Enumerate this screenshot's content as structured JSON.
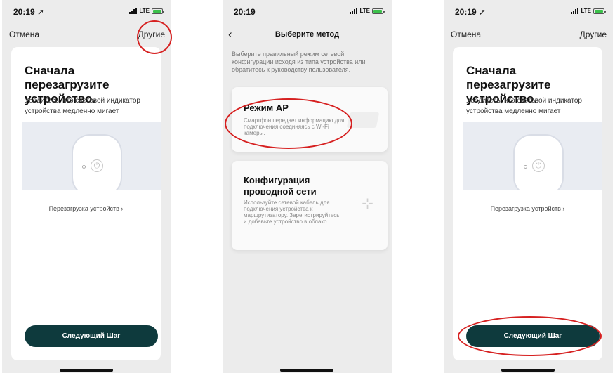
{
  "screens": [
    {
      "status": {
        "time": "20:19",
        "location_glyph": "➚",
        "network": "LTE"
      },
      "nav": {
        "left": "Отмена",
        "right": "Другие"
      },
      "title": "Сначала перезагрузите устройство.",
      "subtitle": "Убедитесь, что световой индикатор устройства медленно мигает",
      "link": "Перезагрузка устройств",
      "button": "Следующий Шаг"
    },
    {
      "status": {
        "time": "20:19",
        "network": "LTE"
      },
      "nav": {
        "back": "‹",
        "title": "Выберите метод"
      },
      "instruction": "Выберите правильный режим сетевой конфигурации исходя из типа устройства или обратитесь к руководству пользователя.",
      "methods": [
        {
          "title": "Режим AP",
          "desc": "Смартфон передает информацию для подключения соединяясь с Wi-Fi камеры."
        },
        {
          "title": "Конфигурация проводной сети",
          "desc": "Используйте сетевой кабель для подключения устройства к маршрутизатору. Зарегистрируйтесь и добавьте устройство в облако."
        }
      ]
    },
    {
      "status": {
        "time": "20:19",
        "location_glyph": "➚",
        "network": "LTE"
      },
      "nav": {
        "left": "Отмена",
        "right": "Другие"
      },
      "title": "Сначала перезагрузите устройство.",
      "subtitle": "Убедитесь, что световой индикатор устройства медленно мигает",
      "link": "Перезагрузка устройств",
      "button": "Следующий Шаг"
    }
  ],
  "icons": {
    "chevron_right": "›",
    "power": "⏻",
    "network": "⊹"
  },
  "colors": {
    "button": "#0e3a3d",
    "highlight": "#d62020",
    "battery": "#3bc14a",
    "background": "#ececec"
  }
}
